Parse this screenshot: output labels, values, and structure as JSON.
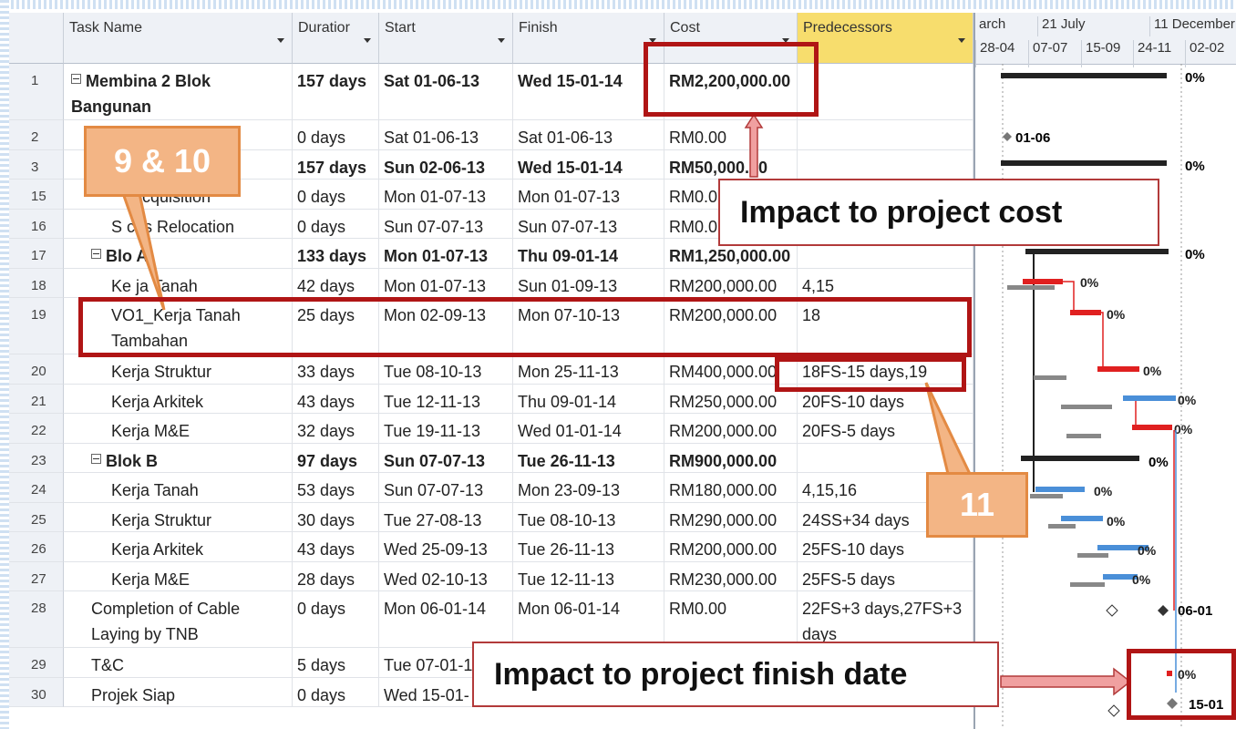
{
  "columns": {
    "id": "",
    "task_name": "Task Name",
    "duration": "Duratior",
    "start": "Start",
    "finish": "Finish",
    "cost": "Cost",
    "predecessors": "Predecessors"
  },
  "rows": [
    {
      "id": "1",
      "name": "Membina 2 Blok Bangunan",
      "duration": "157 days",
      "start": "Sat 01-06-13",
      "finish": "Wed 15-01-14",
      "cost": "RM2,200,000.00",
      "pred": "",
      "bold": true,
      "collapse": true,
      "indent": 0,
      "tall": true
    },
    {
      "id": "2",
      "name": "",
      "duration": "0 days",
      "start": "Sat 01-06-13",
      "finish": "Sat 01-06-13",
      "cost": "RM0.00",
      "pred": "",
      "bold": false,
      "collapse": false,
      "indent": 1,
      "tall": false
    },
    {
      "id": "3",
      "name": "",
      "duration": "157 days",
      "start": "Sun 02-06-13",
      "finish": "Wed 15-01-14",
      "cost": "RM50,000.00",
      "pred": "",
      "bold": true,
      "collapse": false,
      "indent": 1,
      "tall": false
    },
    {
      "id": "15",
      "name": "Acquisition",
      "duration": "0 days",
      "start": "Mon 01-07-13",
      "finish": "Mon 01-07-13",
      "cost": "RM0.0",
      "pred": "",
      "bold": false,
      "collapse": false,
      "indent": 3,
      "tall": false
    },
    {
      "id": "16",
      "name": "S    ces Relocation",
      "duration": "0 days",
      "start": "Sun 07-07-13",
      "finish": "Sun 07-07-13",
      "cost": "RM0.0",
      "pred": "",
      "bold": false,
      "collapse": false,
      "indent": 2,
      "tall": false
    },
    {
      "id": "17",
      "name": "Blo  A",
      "duration": "133 days",
      "start": "Mon 01-07-13",
      "finish": "Thu 09-01-14",
      "cost": "RM1,250,000.00",
      "pred": "",
      "bold": true,
      "collapse": true,
      "indent": 1,
      "tall": false
    },
    {
      "id": "18",
      "name": "Ke  ja Tanah",
      "duration": "42 days",
      "start": "Mon 01-07-13",
      "finish": "Sun 01-09-13",
      "cost": "RM200,000.00",
      "pred": "4,15",
      "bold": false,
      "collapse": false,
      "indent": 2,
      "tall": false
    },
    {
      "id": "19",
      "name": "VO1_Kerja Tanah Tambahan",
      "duration": "25 days",
      "start": "Mon 02-09-13",
      "finish": "Mon 07-10-13",
      "cost": "RM200,000.00",
      "pred": "18",
      "bold": false,
      "collapse": false,
      "indent": 2,
      "tall": true
    },
    {
      "id": "20",
      "name": "Kerja Struktur",
      "duration": "33 days",
      "start": "Tue 08-10-13",
      "finish": "Mon 25-11-13",
      "cost": "RM400,000.00",
      "pred": "18FS-15 days,19",
      "bold": false,
      "collapse": false,
      "indent": 2,
      "tall": false
    },
    {
      "id": "21",
      "name": "Kerja Arkitek",
      "duration": "43 days",
      "start": "Tue 12-11-13",
      "finish": "Thu 09-01-14",
      "cost": "RM250,000.00",
      "pred": "20FS-10 days",
      "bold": false,
      "collapse": false,
      "indent": 2,
      "tall": false
    },
    {
      "id": "22",
      "name": "Kerja M&E",
      "duration": "32 days",
      "start": "Tue 19-11-13",
      "finish": "Wed 01-01-14",
      "cost": "RM200,000.00",
      "pred": "20FS-5 days",
      "bold": false,
      "collapse": false,
      "indent": 2,
      "tall": false
    },
    {
      "id": "23",
      "name": "Blok B",
      "duration": "97 days",
      "start": "Sun 07-07-13",
      "finish": "Tue 26-11-13",
      "cost": "RM900,000.00",
      "pred": "",
      "bold": true,
      "collapse": true,
      "indent": 1,
      "tall": false
    },
    {
      "id": "24",
      "name": "Kerja Tanah",
      "duration": "53 days",
      "start": "Sun 07-07-13",
      "finish": "Mon 23-09-13",
      "cost": "RM180,000.00",
      "pred": "4,15,16",
      "bold": false,
      "collapse": false,
      "indent": 2,
      "tall": false
    },
    {
      "id": "25",
      "name": "Kerja Struktur",
      "duration": "30 days",
      "start": "Tue 27-08-13",
      "finish": "Tue 08-10-13",
      "cost": "RM290,000.00",
      "pred": "24SS+34 days",
      "bold": false,
      "collapse": false,
      "indent": 2,
      "tall": false
    },
    {
      "id": "26",
      "name": "Kerja Arkitek",
      "duration": "43 days",
      "start": "Wed 25-09-13",
      "finish": "Tue 26-11-13",
      "cost": "RM200,000.00",
      "pred": "25FS-10 days",
      "bold": false,
      "collapse": false,
      "indent": 2,
      "tall": false
    },
    {
      "id": "27",
      "name": "Kerja M&E",
      "duration": "28 days",
      "start": "Wed 02-10-13",
      "finish": "Tue 12-11-13",
      "cost": "RM230,000.00",
      "pred": "25FS-5 days",
      "bold": false,
      "collapse": false,
      "indent": 2,
      "tall": false
    },
    {
      "id": "28",
      "name": "Completion of Cable Laying by TNB",
      "duration": "0 days",
      "start": "Mon 06-01-14",
      "finish": "Mon 06-01-14",
      "cost": "RM0.00",
      "pred": "22FS+3 days,27FS+3 days",
      "bold": false,
      "collapse": false,
      "indent": 1,
      "tall": true
    },
    {
      "id": "29",
      "name": "T&C",
      "duration": "5 days",
      "start": "Tue 07-01-1",
      "finish": "",
      "cost": "",
      "pred": "",
      "bold": false,
      "collapse": false,
      "indent": 1,
      "tall": false
    },
    {
      "id": "30",
      "name": "Projek Siap",
      "duration": "0 days",
      "start": "Wed 15-01-",
      "finish": "",
      "cost": "",
      "pred": "",
      "bold": false,
      "collapse": false,
      "indent": 1,
      "tall": false
    }
  ],
  "gantt": {
    "top_labels": [
      "arch",
      "21 July",
      "11 December"
    ],
    "bottom_labels": [
      "28-04",
      "07-07",
      "15-09",
      "24-11",
      "02-02"
    ],
    "bar_labels": [
      "0%",
      "01-06",
      "0%",
      "0%",
      "0%",
      "0%",
      "0%",
      "0%",
      "0%",
      "0%",
      "0%",
      "0%",
      "0%",
      "0%",
      "06-01",
      "0%",
      "15-01"
    ]
  },
  "annotations": {
    "callout_cost": "Impact to project cost",
    "callout_finish": "Impact to project finish date",
    "badge_9_10": "9 & 10",
    "badge_11": "11"
  },
  "colors": {
    "highlight_red": "#b01515",
    "badge_orange": "#f3b585",
    "predecessor_header": "#f7dd6d",
    "critical_bar": "#e02020",
    "normal_bar": "#4a8fd8"
  }
}
